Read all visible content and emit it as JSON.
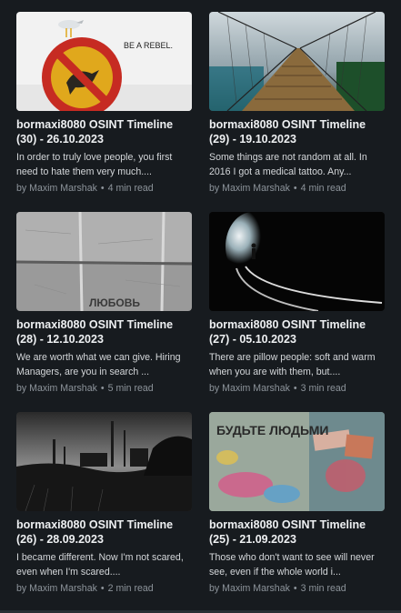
{
  "posts": [
    {
      "title": "bormaxi8080 OSINT Timeline (30) - 26.10.2023",
      "excerpt": "In order to truly love people, you first need to hate them very much....",
      "author": "by Maxim Marshak",
      "read_time": "4 min read",
      "image_text": "BE A REBEL.",
      "image_icon": "no-bird-sign-icon"
    },
    {
      "title": "bormaxi8080 OSINT Timeline (29) - 19.10.2023",
      "excerpt": "Some things are not random at all. In 2016 I got a medical tattoo. Any...",
      "author": "by Maxim Marshak",
      "read_time": "4 min read",
      "image_icon": "rope-bridge-image"
    },
    {
      "title": "bormaxi8080 OSINT Timeline (28) - 12.10.2023",
      "excerpt": "We are worth what we can give. Hiring Managers, are you in search ...",
      "author": "by Maxim Marshak",
      "read_time": "5 min read",
      "image_text": "ЛЮБОВЬ",
      "image_icon": "concrete-wall-image"
    },
    {
      "title": "bormaxi8080 OSINT Timeline (27) - 05.10.2023",
      "excerpt": "There are pillow people: soft and warm when you are with them, but....",
      "author": "by Maxim Marshak",
      "read_time": "3 min read",
      "image_icon": "tunnel-railway-image"
    },
    {
      "title": "bormaxi8080 OSINT Timeline (26) - 28.09.2023",
      "excerpt": "I became different. Now I'm not scared, even when I'm scared....",
      "author": "by Maxim Marshak",
      "read_time": "2 min read",
      "image_icon": "industrial-landscape-image"
    },
    {
      "title": "bormaxi8080 OSINT Timeline (25) - 21.09.2023",
      "excerpt": "Those who don't want to see will never see, even if the whole world i...",
      "author": "by Maxim Marshak",
      "read_time": "3 min read",
      "image_text": "БУДЬТЕ ЛЮДЬМИ",
      "image_icon": "graffiti-wall-image"
    }
  ]
}
